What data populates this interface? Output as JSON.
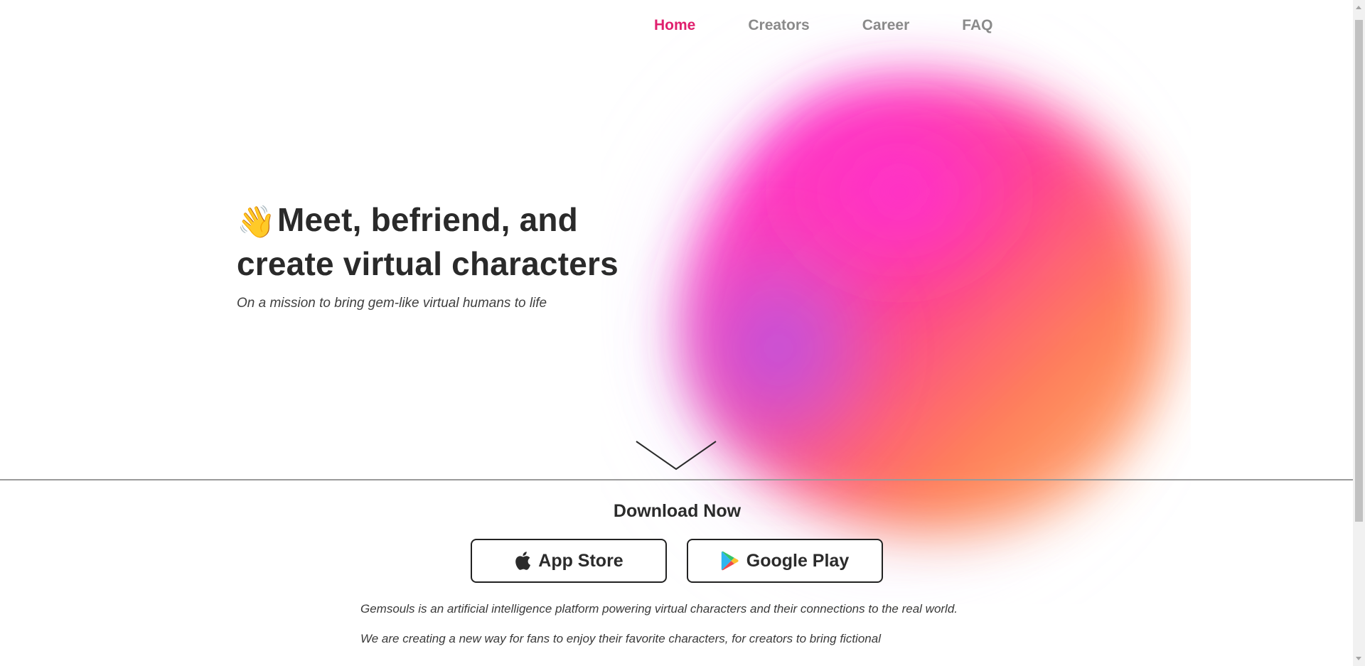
{
  "nav": {
    "items": [
      {
        "label": "Home",
        "active": true
      },
      {
        "label": "Creators",
        "active": false
      },
      {
        "label": "Career",
        "active": false
      },
      {
        "label": "FAQ",
        "active": false
      }
    ]
  },
  "hero": {
    "emoji": "👋",
    "title_line1": "Meet, befriend, and",
    "title_line2": "create virtual characters",
    "subtitle": "On a mission to bring gem-like virtual humans to life"
  },
  "download": {
    "title": "Download Now",
    "app_store_label": "App Store",
    "google_play_label": "Google Play"
  },
  "about": {
    "paragraph1": "Gemsouls is an artificial intelligence platform powering virtual characters and their connections to the real world.",
    "paragraph2": "We are creating a new way for fans to enjoy their favorite characters, for creators to bring fictional"
  },
  "icons": {
    "hero_emoji": "waving-hand-icon",
    "scroll": "chevron-down-icon",
    "app_store": "apple-icon",
    "google_play": "google-play-icon"
  },
  "colors": {
    "accent": "#e0206e",
    "nav_inactive": "#8a8a8a",
    "text_dark": "#2a2a2a",
    "blob_pink": "#ff2fb8",
    "blob_orange": "#ff7b4a",
    "blob_violet": "#b46ef0"
  }
}
